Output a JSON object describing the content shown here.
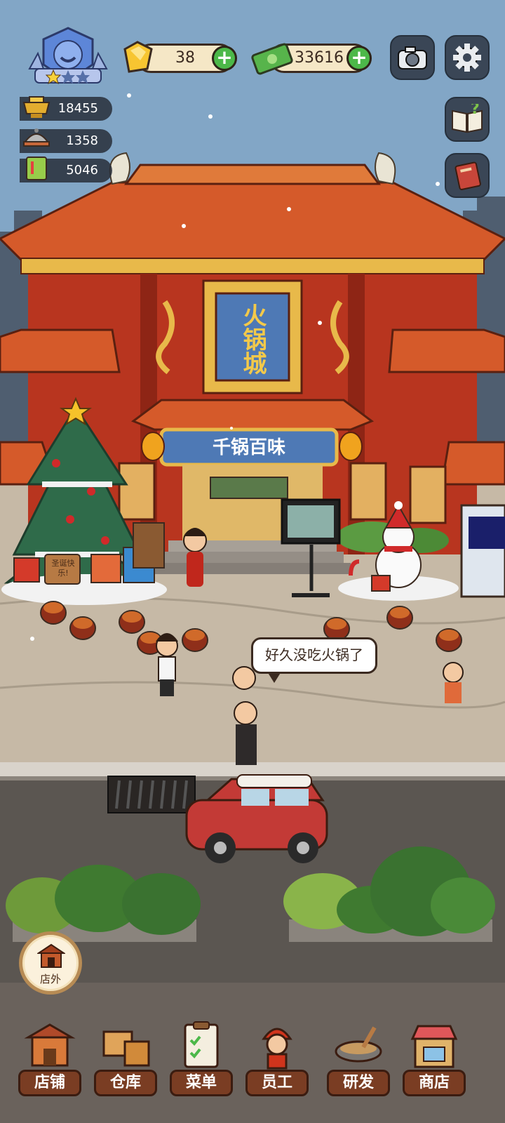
{
  "hud": {
    "gems": "38",
    "cash": "33616",
    "stats": [
      {
        "name": "reputation",
        "value": "18455"
      },
      {
        "name": "dishes-served",
        "value": "1358"
      },
      {
        "name": "recipes",
        "value": "5046"
      }
    ]
  },
  "restaurant": {
    "vertical_sign": "火锅城",
    "banner": "千锅百味",
    "tree_sign": "圣诞快乐!"
  },
  "speech_bubble": "好久没吃火锅了",
  "outside_button": "店外",
  "nav": [
    {
      "label": "店铺"
    },
    {
      "label": "仓库"
    },
    {
      "label": "菜单"
    },
    {
      "label": "员工"
    },
    {
      "label": "研发"
    },
    {
      "label": "商店"
    }
  ],
  "colors": {
    "sky": "#7fa3c4",
    "roof": "#d55a2a",
    "wall": "#b8351f",
    "pavement": "#c6b9a6",
    "road": "#5b5651",
    "nav_label": "#7a3d23",
    "plus_button": "#4cb849"
  }
}
